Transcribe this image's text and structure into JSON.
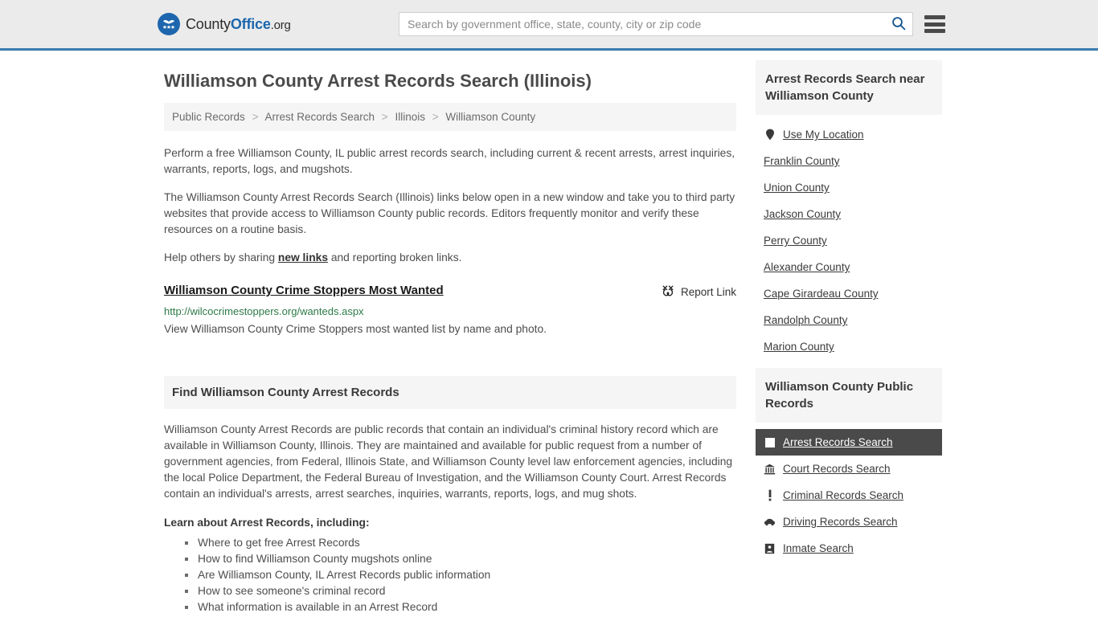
{
  "header": {
    "logo": {
      "part1": "County",
      "part2": "Office",
      "part3": ".org",
      "icon": "eagle-star-emblem"
    },
    "search": {
      "placeholder": "Search by government office, state, county, city or zip code",
      "value": "",
      "icon": "search-icon"
    },
    "menu_icon": "hamburger-menu-icon"
  },
  "page": {
    "title": "Williamson County Arrest Records Search (Illinois)"
  },
  "breadcrumb": {
    "separator": ">",
    "items": [
      {
        "label": "Public Records"
      },
      {
        "label": "Arrest Records Search"
      },
      {
        "label": "Illinois"
      },
      {
        "label": "Williamson County"
      }
    ]
  },
  "intro": {
    "p1": "Perform a free Williamson County, IL public arrest records search, including current & recent arrests, arrest inquiries, warrants, reports, logs, and mugshots.",
    "p2": "The Williamson County Arrest Records Search (Illinois) links below open in a new window and take you to third party websites that provide access to Williamson County public records. Editors frequently monitor and verify these resources on a routine basis.",
    "p3_before": "Help others by sharing ",
    "p3_link": "new links",
    "p3_after": " and reporting broken links."
  },
  "result": {
    "title": "Williamson County Crime Stoppers Most Wanted",
    "url": "http://wilcocrimestoppers.org/wanteds.aspx",
    "description": "View Williamson County Crime Stoppers most wanted list by name and photo.",
    "report_label": "Report Link",
    "report_icon": "broken-link-icon"
  },
  "find_section": {
    "heading": "Find Williamson County Arrest Records",
    "body": "Williamson County Arrest Records are public records that contain an individual's criminal history record which are available in Williamson County, Illinois. They are maintained and available for public request from a number of government agencies, from Federal, Illinois State, and Williamson County level law enforcement agencies, including the local Police Department, the Federal Bureau of Investigation, and the Williamson County Court. Arrest Records contain an individual's arrests, arrest searches, inquiries, warrants, reports, logs, and mug shots.",
    "lead_in": "Learn about Arrest Records, including:",
    "bullets": [
      "Where to get free Arrest Records",
      "How to find Williamson County mugshots online",
      "Are Williamson County, IL Arrest Records public information",
      "How to see someone's criminal record",
      "What information is available in an Arrest Record"
    ]
  },
  "sidebar": {
    "nearby": {
      "heading": "Arrest Records Search near Williamson County",
      "items": [
        {
          "label": "Use My Location",
          "icon": "map-pin-icon"
        },
        {
          "label": "Franklin County",
          "icon": ""
        },
        {
          "label": "Union County",
          "icon": ""
        },
        {
          "label": "Jackson County",
          "icon": ""
        },
        {
          "label": "Perry County",
          "icon": ""
        },
        {
          "label": "Alexander County",
          "icon": ""
        },
        {
          "label": "Cape Girardeau County",
          "icon": ""
        },
        {
          "label": "Randolph County",
          "icon": ""
        },
        {
          "label": "Marion County",
          "icon": ""
        }
      ]
    },
    "public_records": {
      "heading": "Williamson County Public Records",
      "items": [
        {
          "label": "Arrest Records Search",
          "icon": "document-square-icon",
          "active": true
        },
        {
          "label": "Court Records Search",
          "icon": "courthouse-icon",
          "active": false
        },
        {
          "label": "Criminal Records Search",
          "icon": "exclamation-icon",
          "active": false
        },
        {
          "label": "Driving Records Search",
          "icon": "car-icon",
          "active": false
        },
        {
          "label": "Inmate Search",
          "icon": "inmate-icon",
          "active": false
        }
      ]
    }
  },
  "colors": {
    "accent_blue": "#1d66ad",
    "header_rule": "#3d7ab0",
    "header_bg": "#ebebeb",
    "panel_bg": "#f5f5f5",
    "active_bg": "#4a4a4a",
    "url_green": "#2c7a47",
    "text": "#4d4d4d"
  }
}
